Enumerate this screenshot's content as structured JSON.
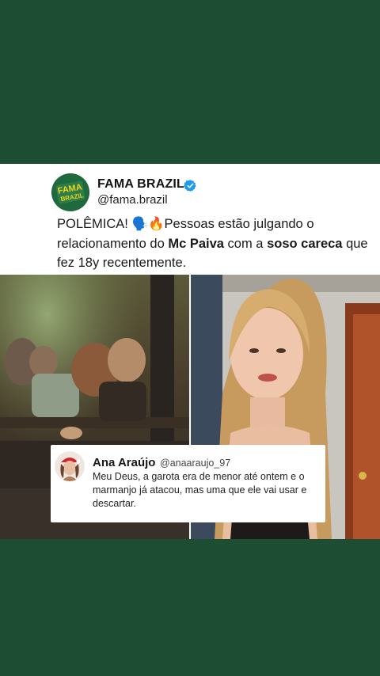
{
  "post": {
    "account_name": "FAMA BRAZIL",
    "handle": "@fama.brazil",
    "logo_text_top": "FAMA",
    "logo_text_bottom": "BRAZIL",
    "caption": {
      "part1": "POLÊMICA! 🗣️🔥Pessoas estão julgando o relacionamento do ",
      "bold1": "Mc Paiva",
      "part2": " com a ",
      "bold2": "soso careca",
      "part3": " que fez 18y recentemente."
    }
  },
  "comment": {
    "name": "Ana Araújo",
    "handle": "@anaaraujo_97",
    "text": "Meu Deus, a garota era de menor até ontem e o marmanjo já atacou, mas uma que ele vai usar e descartar."
  },
  "colors": {
    "background": "#1d4d32",
    "card": "#ffffff",
    "verified": "#1d9bf0"
  }
}
